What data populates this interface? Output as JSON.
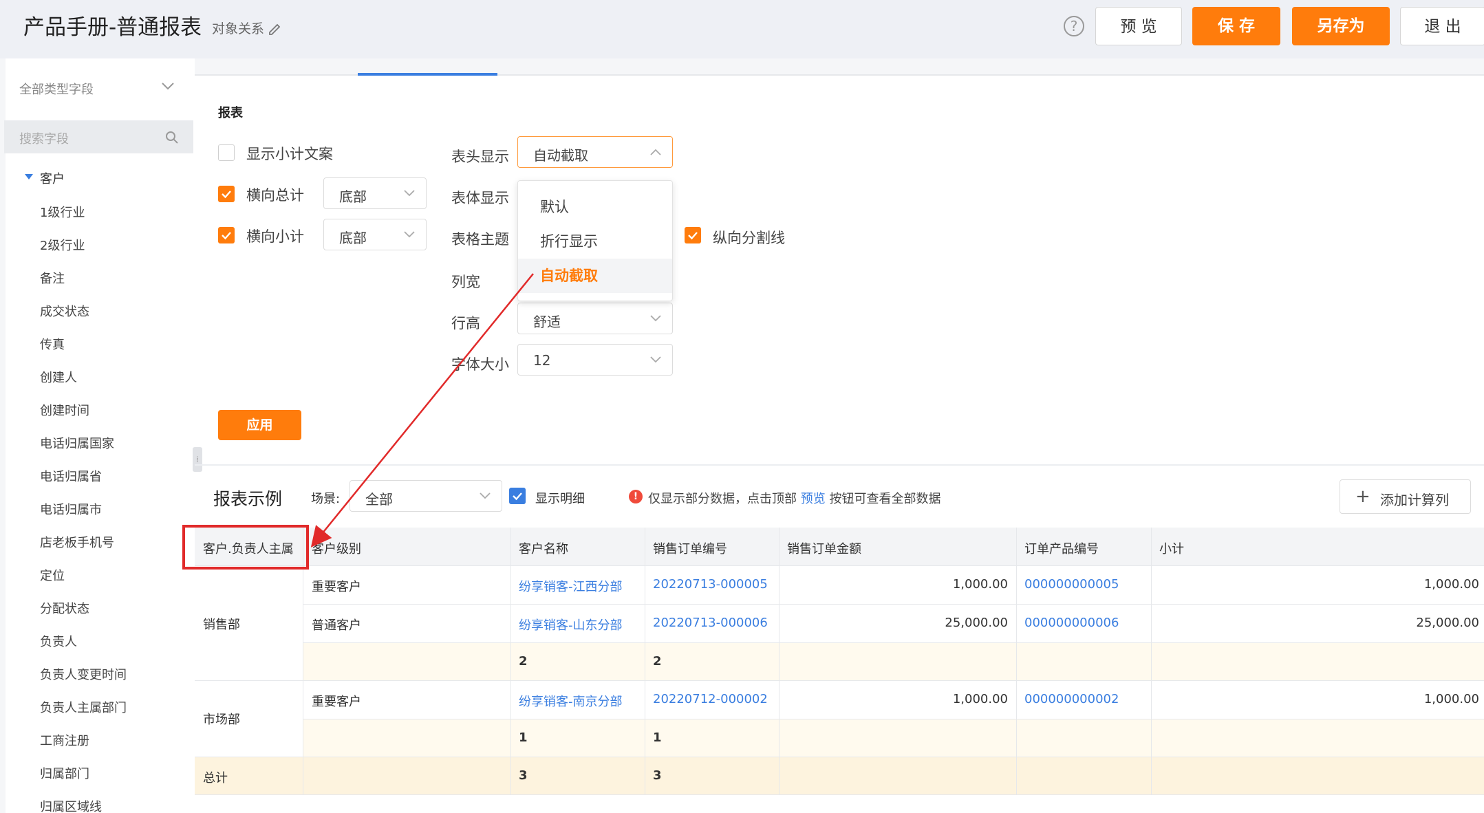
{
  "header": {
    "title": "产品手册-普通报表",
    "subtitle": "对象关系",
    "buttons": {
      "preview": "预 览",
      "save": "保 存",
      "save_as": "另存为",
      "exit": "退 出"
    },
    "help": "?"
  },
  "sidebar": {
    "field_type": "全部类型字段",
    "search_placeholder": "搜索字段",
    "tree_root": "客户",
    "items": [
      "1级行业",
      "2级行业",
      "备注",
      "成交状态",
      "传真",
      "创建人",
      "创建时间",
      "电话归属国家",
      "电话归属省",
      "电话归属市",
      "店老板手机号",
      "定位",
      "分配状态",
      "负责人",
      "负责人变更时间",
      "负责人主属部门",
      "工商注册",
      "归属部门",
      "归属区域线"
    ]
  },
  "settings": {
    "section_title": "报表",
    "show_subtotal_text": "显示小计文案",
    "horizontal_total": "横向总计",
    "horizontal_total_value": "底部",
    "horizontal_subtotal": "横向小计",
    "horizontal_subtotal_value": "底部",
    "header_display": "表头显示",
    "header_display_value": "自动截取",
    "body_display": "表体显示",
    "table_theme": "表格主题",
    "vertical_divider": "纵向分割线",
    "column_width": "列宽",
    "row_height": "行高",
    "row_height_value": "舒适",
    "font_size": "字体大小",
    "font_size_value": "12",
    "dropdown_options": [
      "默认",
      "折行显示",
      "自动截取"
    ],
    "apply": "应用"
  },
  "example": {
    "title": "报表示例",
    "scene_label": "场景:",
    "scene_value": "全部",
    "show_detail": "显示明细",
    "notice_prefix": "仅显示部分数据，点击顶部 ",
    "notice_link": "预览",
    "notice_suffix": " 按钮可查看全部数据",
    "add_calc_column": "添加计算列"
  },
  "table": {
    "columns": [
      "客户.负责人主属",
      "客户级别",
      "客户名称",
      "销售订单编号",
      "销售订单金额",
      "订单产品编号",
      "小计"
    ],
    "groups": [
      {
        "department": "销售部",
        "rows": [
          {
            "level": "重要客户",
            "name": "纷享销客-江西分部",
            "order_no": "20220713-000005",
            "amount": "1,000.00",
            "product_no": "000000000005",
            "subtotal": "1,000.00"
          },
          {
            "level": "普通客户",
            "name": "纷享销客-山东分部",
            "order_no": "20220713-000006",
            "amount": "25,000.00",
            "product_no": "000000000006",
            "subtotal": "25,000.00"
          }
        ],
        "sub_name": "2",
        "sub_order": "2"
      },
      {
        "department": "市场部",
        "rows": [
          {
            "level": "重要客户",
            "name": "纷享销客-南京分部",
            "order_no": "20220712-000002",
            "amount": "1,000.00",
            "product_no": "000000000002",
            "subtotal": "1,000.00"
          }
        ],
        "sub_name": "1",
        "sub_order": "1"
      }
    ],
    "total_label": "总计",
    "total_name": "3",
    "total_order": "3"
  },
  "colors": {
    "accent": "#ff7c0c",
    "link": "#3a7ee0",
    "annotation": "#e12a2a"
  }
}
